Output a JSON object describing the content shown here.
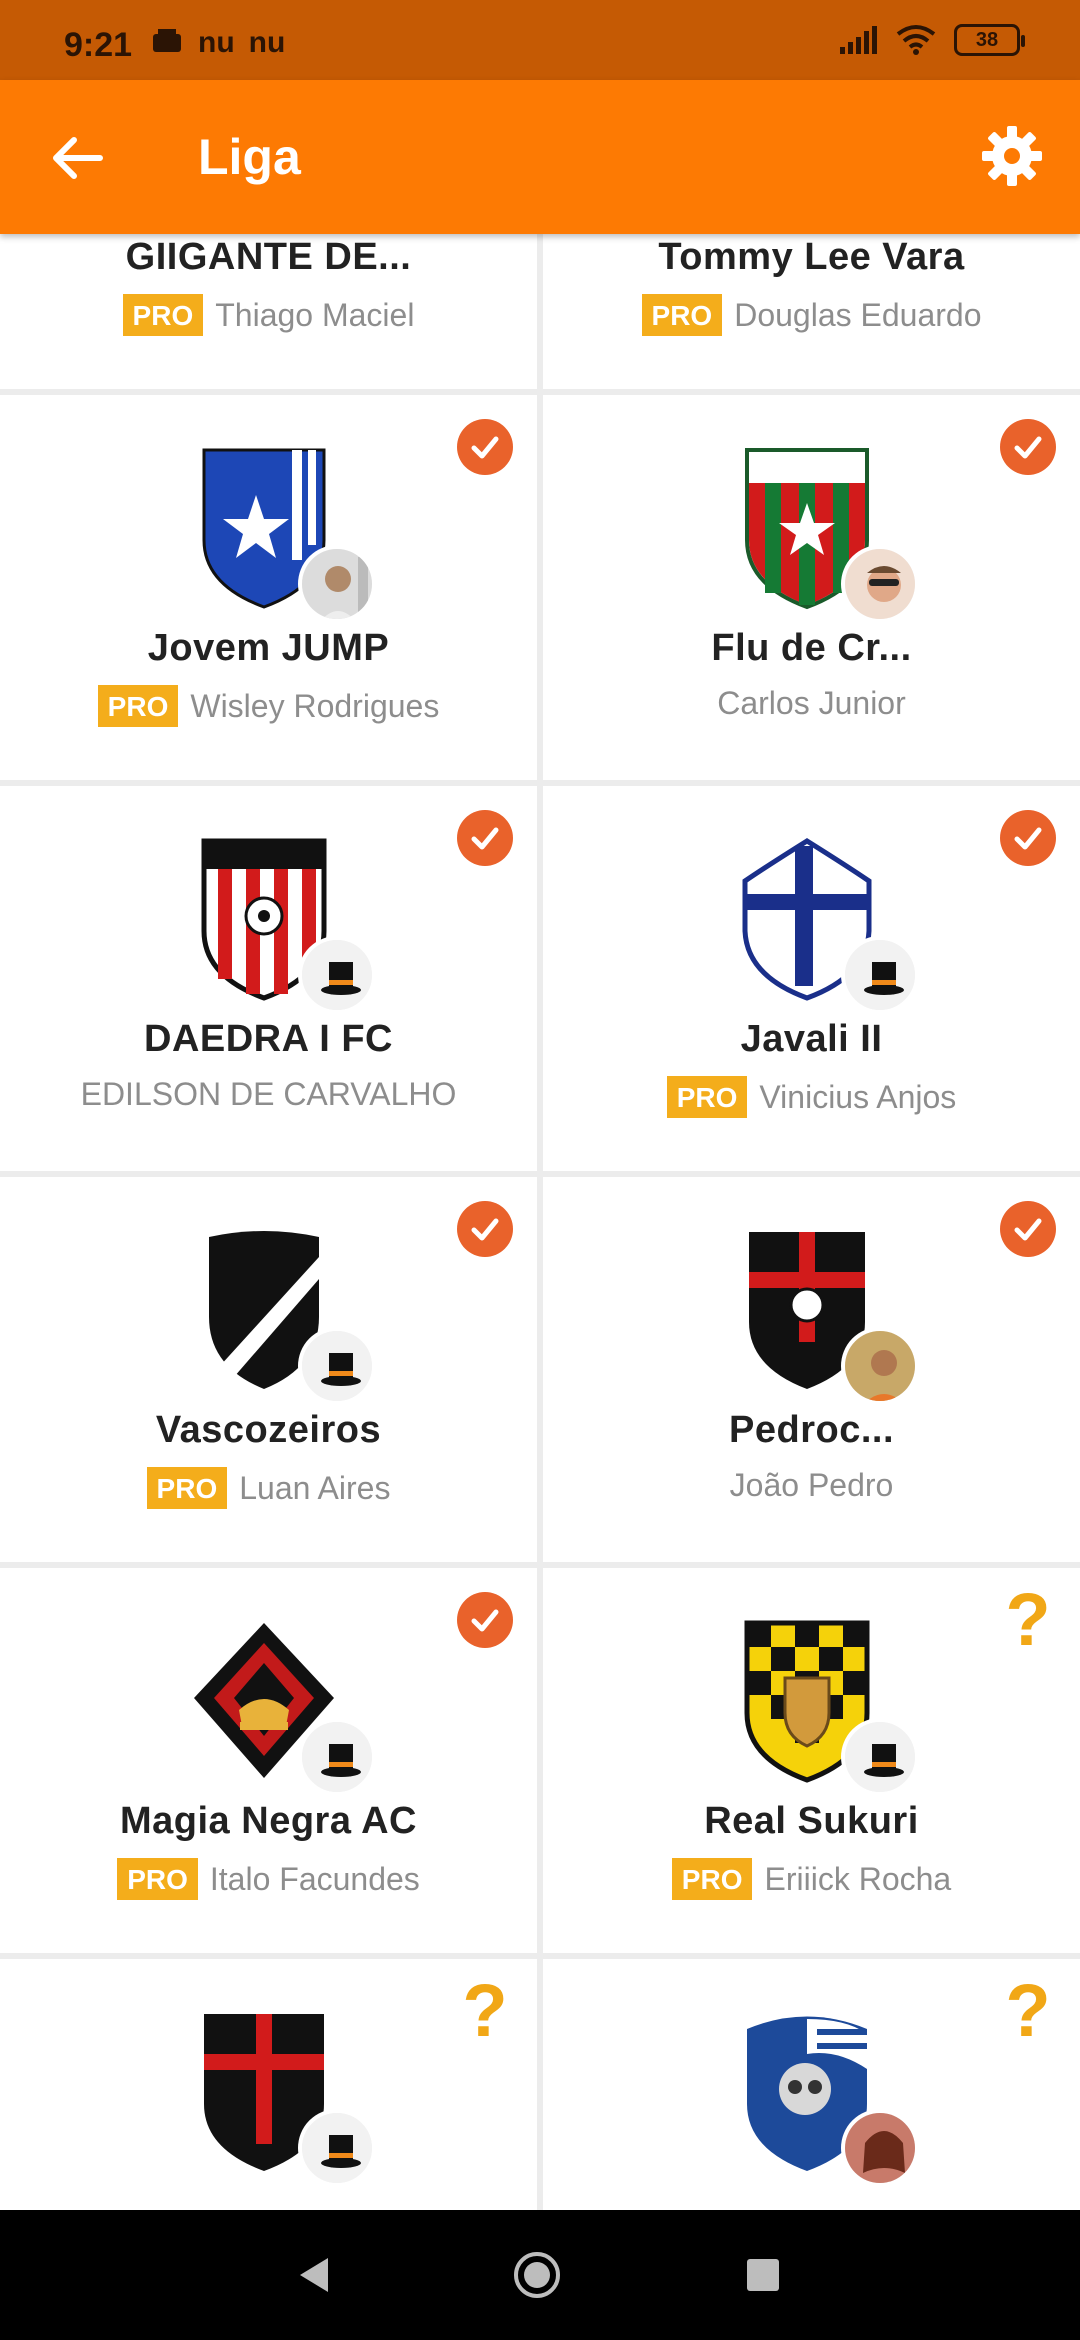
{
  "status_bar": {
    "time": "9:21",
    "notif_icons": [
      "nu",
      "nu"
    ],
    "battery": "38"
  },
  "app_bar": {
    "title": "Liga"
  },
  "colors": {
    "accent": "#fd7a03",
    "status_bar": "#c55a04",
    "check": "#e9622b",
    "pro_badge": "#f4ad1b"
  },
  "teams": [
    {
      "name": "GIIGANTE DE...",
      "owner": "Thiago Maciel",
      "pro": true,
      "status": "none",
      "pro_label": "PRO"
    },
    {
      "name": "Tommy Lee Vara",
      "owner": "Douglas Eduardo",
      "pro": true,
      "status": "none",
      "pro_label": "PRO"
    },
    {
      "name": "Jovem  JUMP",
      "owner": "Wisley Rodrigues",
      "pro": true,
      "status": "check",
      "pro_label": "PRO"
    },
    {
      "name": "Flu de Cr...",
      "owner": "Carlos Junior",
      "pro": false,
      "status": "check",
      "pro_label": ""
    },
    {
      "name": "DAEDRA I FC",
      "owner": "EDILSON DE CARVALHO",
      "pro": false,
      "status": "check",
      "pro_label": ""
    },
    {
      "name": "Javali II",
      "owner": "Vinicius Anjos",
      "pro": true,
      "status": "check",
      "pro_label": "PRO"
    },
    {
      "name": "Vascozeiros",
      "owner": "Luan Aires",
      "pro": true,
      "status": "check",
      "pro_label": "PRO"
    },
    {
      "name": "Pedroc...",
      "owner": "João Pedro",
      "pro": false,
      "status": "check",
      "pro_label": ""
    },
    {
      "name": "Magia Negra AC",
      "owner": "Italo Facundes",
      "pro": true,
      "status": "check",
      "pro_label": "PRO"
    },
    {
      "name": "Real Sukuri",
      "owner": "Eriiick Rocha",
      "pro": true,
      "status": "question",
      "pro_label": "PRO"
    },
    {
      "name": "",
      "owner": "",
      "pro": false,
      "status": "question",
      "pro_label": ""
    },
    {
      "name": "",
      "owner": "",
      "pro": false,
      "status": "question",
      "pro_label": ""
    }
  ],
  "status_question_mark": "?"
}
